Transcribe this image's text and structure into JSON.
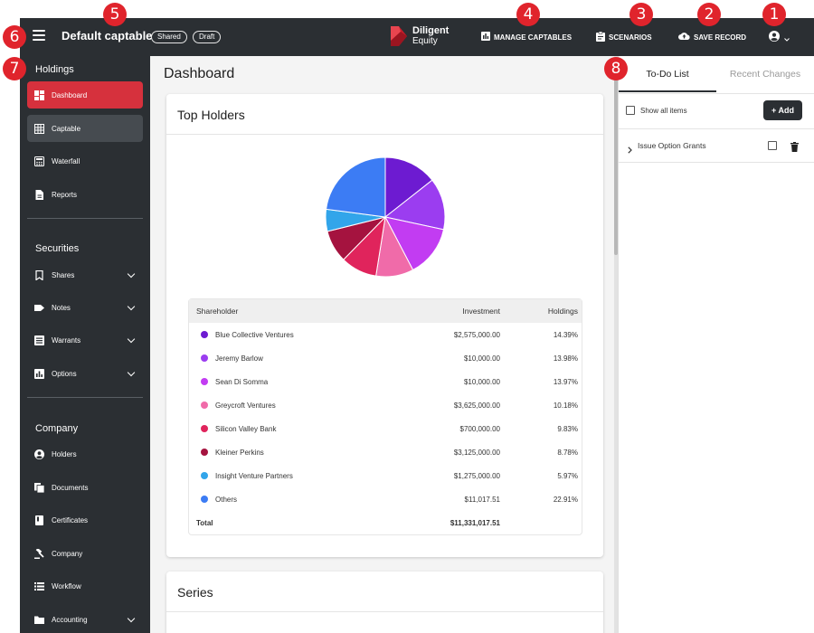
{
  "topbar": {
    "title": "Default captable",
    "badges": [
      "Shared",
      "Draft"
    ],
    "brand_name": "Diligent",
    "brand_sub": "Equity",
    "nav": [
      {
        "label": "MANAGE CAPTABLES",
        "icon": "bar-chart-icon"
      },
      {
        "label": "SCENARIOS",
        "icon": "clipboard-icon"
      },
      {
        "label": "SAVE RECORD",
        "icon": "cloud-upload-icon"
      }
    ],
    "user_icon": "account-circle-icon"
  },
  "sidebar": {
    "sections": [
      {
        "title": "Holdings",
        "items": [
          {
            "label": "Dashboard",
            "icon": "dashboard-icon",
            "state": "active"
          },
          {
            "label": "Captable",
            "icon": "grid-icon",
            "state": "hover"
          },
          {
            "label": "Waterfall",
            "icon": "calculator-icon"
          },
          {
            "label": "Reports",
            "icon": "document-icon"
          }
        ]
      },
      {
        "title": "Securities",
        "items": [
          {
            "label": "Shares",
            "icon": "bookmark-icon",
            "expandable": true
          },
          {
            "label": "Notes",
            "icon": "tag-icon",
            "expandable": true
          },
          {
            "label": "Warrants",
            "icon": "list-icon",
            "expandable": true
          },
          {
            "label": "Options",
            "icon": "chart-icon",
            "expandable": true
          }
        ]
      },
      {
        "title": "Company",
        "items": [
          {
            "label": "Holders",
            "icon": "account-icon"
          },
          {
            "label": "Documents",
            "icon": "copy-icon"
          },
          {
            "label": "Certificates",
            "icon": "certificate-icon"
          },
          {
            "label": "Company",
            "icon": "gavel-icon"
          },
          {
            "label": "Workflow",
            "icon": "list-icon"
          },
          {
            "label": "Accounting",
            "icon": "folder-icon",
            "expandable": true
          }
        ]
      }
    ]
  },
  "main": {
    "page_title": "Dashboard",
    "top_holders": {
      "title": "Top Holders",
      "columns": [
        "Shareholder",
        "Investment",
        "Holdings"
      ],
      "rows": [
        {
          "name": "Blue Collective Ventures",
          "investment": "$2,575,000.00",
          "holdings": "14.39%",
          "color": "#6d1bd1"
        },
        {
          "name": "Jeremy Barlow",
          "investment": "$10,000.00",
          "holdings": "13.98%",
          "color": "#9b3df0"
        },
        {
          "name": "Sean Di Somma",
          "investment": "$10,000.00",
          "holdings": "13.97%",
          "color": "#c23cf2"
        },
        {
          "name": "Greycroft Ventures",
          "investment": "$3,625,000.00",
          "holdings": "10.18%",
          "color": "#f06ba9"
        },
        {
          "name": "Silicon Valley Bank",
          "investment": "$700,000.00",
          "holdings": "9.83%",
          "color": "#e0245c"
        },
        {
          "name": "Kleiner Perkins",
          "investment": "$3,125,000.00",
          "holdings": "8.78%",
          "color": "#a5133f"
        },
        {
          "name": "Insight Venture Partners",
          "investment": "$1,275,000.00",
          "holdings": "5.97%",
          "color": "#32a5ea"
        },
        {
          "name": "Others",
          "investment": "$11,017.51",
          "holdings": "22.91%",
          "color": "#3c7cf4"
        }
      ],
      "total_label": "Total",
      "total_investment": "$11,331,017.51"
    },
    "series": {
      "title": "Series"
    }
  },
  "chart_data": {
    "type": "pie",
    "categories": [
      "Blue Collective Ventures",
      "Jeremy Barlow",
      "Sean Di Somma",
      "Greycroft Ventures",
      "Silicon Valley Bank",
      "Kleiner Perkins",
      "Insight Venture Partners",
      "Others"
    ],
    "values": [
      14.39,
      13.98,
      13.97,
      10.18,
      9.83,
      8.78,
      5.97,
      22.91
    ],
    "colors": [
      "#6d1bd1",
      "#9b3df0",
      "#c23cf2",
      "#f06ba9",
      "#e0245c",
      "#a5133f",
      "#32a5ea",
      "#3c7cf4"
    ],
    "title": "",
    "legend": "none"
  },
  "right_panel": {
    "tabs": [
      "To-Do List",
      "Recent Changes"
    ],
    "active_tab": "To-Do List",
    "show_all_label": "Show all items",
    "add_label": "+ Add",
    "todo_items": [
      {
        "label": "Issue Option Grants"
      }
    ]
  },
  "annotations": [
    "1",
    "2",
    "3",
    "4",
    "5",
    "6",
    "7",
    "8"
  ]
}
